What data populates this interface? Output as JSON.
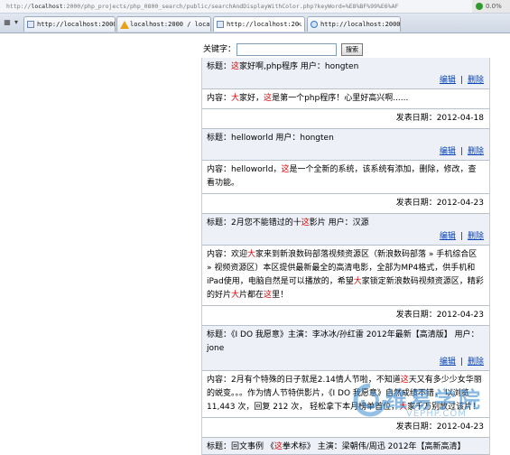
{
  "browser": {
    "address_prefix": "http://",
    "address_host": "localhost",
    "address_rest": ":2000/php_projects/php_0800_search/public/searchAndDisplayWithColor.php?keyWord=%E8%BF%99%E6%AF",
    "status_text": "0.0%",
    "tabs": [
      {
        "label": "http://localhost:2000/...",
        "icon": "page-icon"
      },
      {
        "label": "localhost:2000 / local...",
        "icon": "warning-icon"
      },
      {
        "label": "http://localhost:20...",
        "icon": "page-icon",
        "active": true
      },
      {
        "label": "http://localhost:2000/...",
        "icon": "globe-icon"
      }
    ]
  },
  "search": {
    "label": "关键字：",
    "value": "",
    "button": "搜索"
  },
  "actions": {
    "edit": "编辑",
    "delete": "删除",
    "separator": "|"
  },
  "posts": [
    {
      "title_segments": [
        {
          "t": "标题："
        },
        {
          "t": "这",
          "hl": true
        },
        {
          "t": "家好啊,php程序 用户：hongten"
        }
      ],
      "content_segments": [
        {
          "t": "内容："
        },
        {
          "t": "大",
          "hl": true
        },
        {
          "t": "家好，"
        },
        {
          "t": "这",
          "hl": true
        },
        {
          "t": "是第一个php程序！心里好高兴啊......"
        }
      ],
      "date": "发表日期：2012-04-18"
    },
    {
      "title_segments": [
        {
          "t": "标题：helloworld 用户：hongten"
        }
      ],
      "content_segments": [
        {
          "t": "内容：helloworld，"
        },
        {
          "t": "这",
          "hl": true
        },
        {
          "t": "是一个全新的系统，该系统有添加，删除，修改，查看功能。"
        }
      ],
      "date": "发表日期：2012-04-23"
    },
    {
      "title_segments": [
        {
          "t": "标题：2月您不能错过的十"
        },
        {
          "t": "这",
          "hl": true
        },
        {
          "t": "影片 用户：汉源"
        }
      ],
      "content_segments": [
        {
          "t": "内容：欢迎"
        },
        {
          "t": "大",
          "hl": true
        },
        {
          "t": "家来到新浪数码部落视频资源区（新浪数码部落 » 手机综合区 » 视频资源区）本区提供最新最全的高清电影，全部为MP4格式，供手机和iPad使用，电脑自然是可以播放的，希望"
        },
        {
          "t": "大",
          "hl": true
        },
        {
          "t": "家锁定新浪数码视频资源区，精彩的好片"
        },
        {
          "t": "大",
          "hl": true
        },
        {
          "t": "片都在"
        },
        {
          "t": "这",
          "hl": true
        },
        {
          "t": "里！"
        }
      ],
      "date": "发表日期：2012-04-23"
    },
    {
      "title_segments": [
        {
          "t": "标题：《I DO 我愿意》主演：李冰冰/孙红雷 2012年最新【高清版】 用户：jone"
        }
      ],
      "content_segments": [
        {
          "t": "内容：2月有个特殊的日子就是2.14情人节啦，不知道"
        },
        {
          "t": "这",
          "hl": true
        },
        {
          "t": "天又有多少少女华丽的蜕变。。。作为情人节特供影片，《I DO 我愿意》自然成绩不错， 以浏览11,443 次，回复 212 次， 轻松拿下本月榜单首位，"
        },
        {
          "t": "大",
          "hl": true
        },
        {
          "t": "家千万别放过该片！"
        }
      ],
      "date": "发表日期：2012-04-23"
    },
    {
      "title_segments": [
        {
          "t": "标题：回文事例 《"
        },
        {
          "t": "这",
          "hl": true
        },
        {
          "t": "拳术标》 主演：梁朝伟/周迅 2012年【高新高清】"
        }
      ]
    }
  ],
  "watermark": {
    "text": "维易学院",
    "url": "VEPHP.COM"
  }
}
